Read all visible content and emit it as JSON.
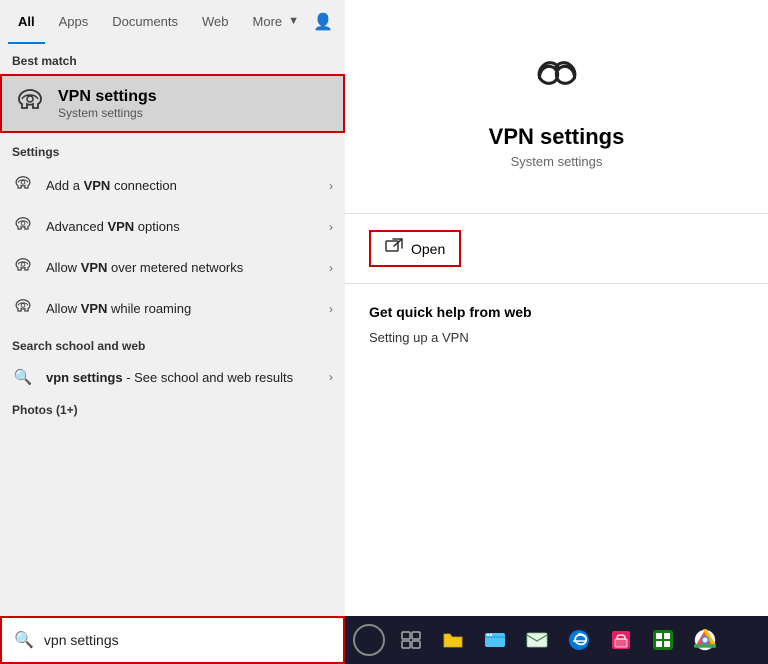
{
  "tabs": {
    "items": [
      {
        "label": "All",
        "active": true
      },
      {
        "label": "Apps",
        "active": false
      },
      {
        "label": "Documents",
        "active": false
      },
      {
        "label": "Web",
        "active": false
      },
      {
        "label": "More",
        "active": false
      }
    ]
  },
  "best_match": {
    "section_label": "Best match",
    "item": {
      "title": "VPN settings",
      "subtitle": "System settings"
    }
  },
  "settings": {
    "section_label": "Settings",
    "items": [
      {
        "label_pre": "Add a ",
        "label_bold": "VPN",
        "label_post": " connection"
      },
      {
        "label_pre": "Advanced ",
        "label_bold": "VPN",
        "label_post": " options"
      },
      {
        "label_pre": "Allow ",
        "label_bold": "VPN",
        "label_post": " over metered networks"
      },
      {
        "label_pre": "Allow ",
        "label_bold": "VPN",
        "label_post": " while roaming"
      }
    ]
  },
  "web": {
    "section_label": "Search school and web",
    "item": {
      "label_bold": "vpn settings",
      "label_post": " - See school and web results"
    }
  },
  "photos": {
    "section_label": "Photos (1+)"
  },
  "search_box": {
    "value": "vpn settings",
    "placeholder": "vpn settings"
  },
  "detail": {
    "title": "VPN settings",
    "subtitle": "System settings",
    "open_button": "Open",
    "quick_help_title": "Get quick help from web",
    "quick_help_link": "Setting up a VPN"
  },
  "taskbar": {
    "buttons": [
      {
        "name": "cortana-circle",
        "symbol": "○"
      },
      {
        "name": "task-view",
        "symbol": "⧉"
      },
      {
        "name": "file-explorer",
        "symbol": "📁"
      },
      {
        "name": "windows-explorer",
        "symbol": "🖥"
      },
      {
        "name": "mail",
        "symbol": "✉"
      },
      {
        "name": "edge",
        "symbol": "e"
      },
      {
        "name": "store",
        "symbol": "🛍"
      },
      {
        "name": "xbox",
        "symbol": "⊞"
      },
      {
        "name": "chrome",
        "symbol": "◎"
      }
    ]
  }
}
